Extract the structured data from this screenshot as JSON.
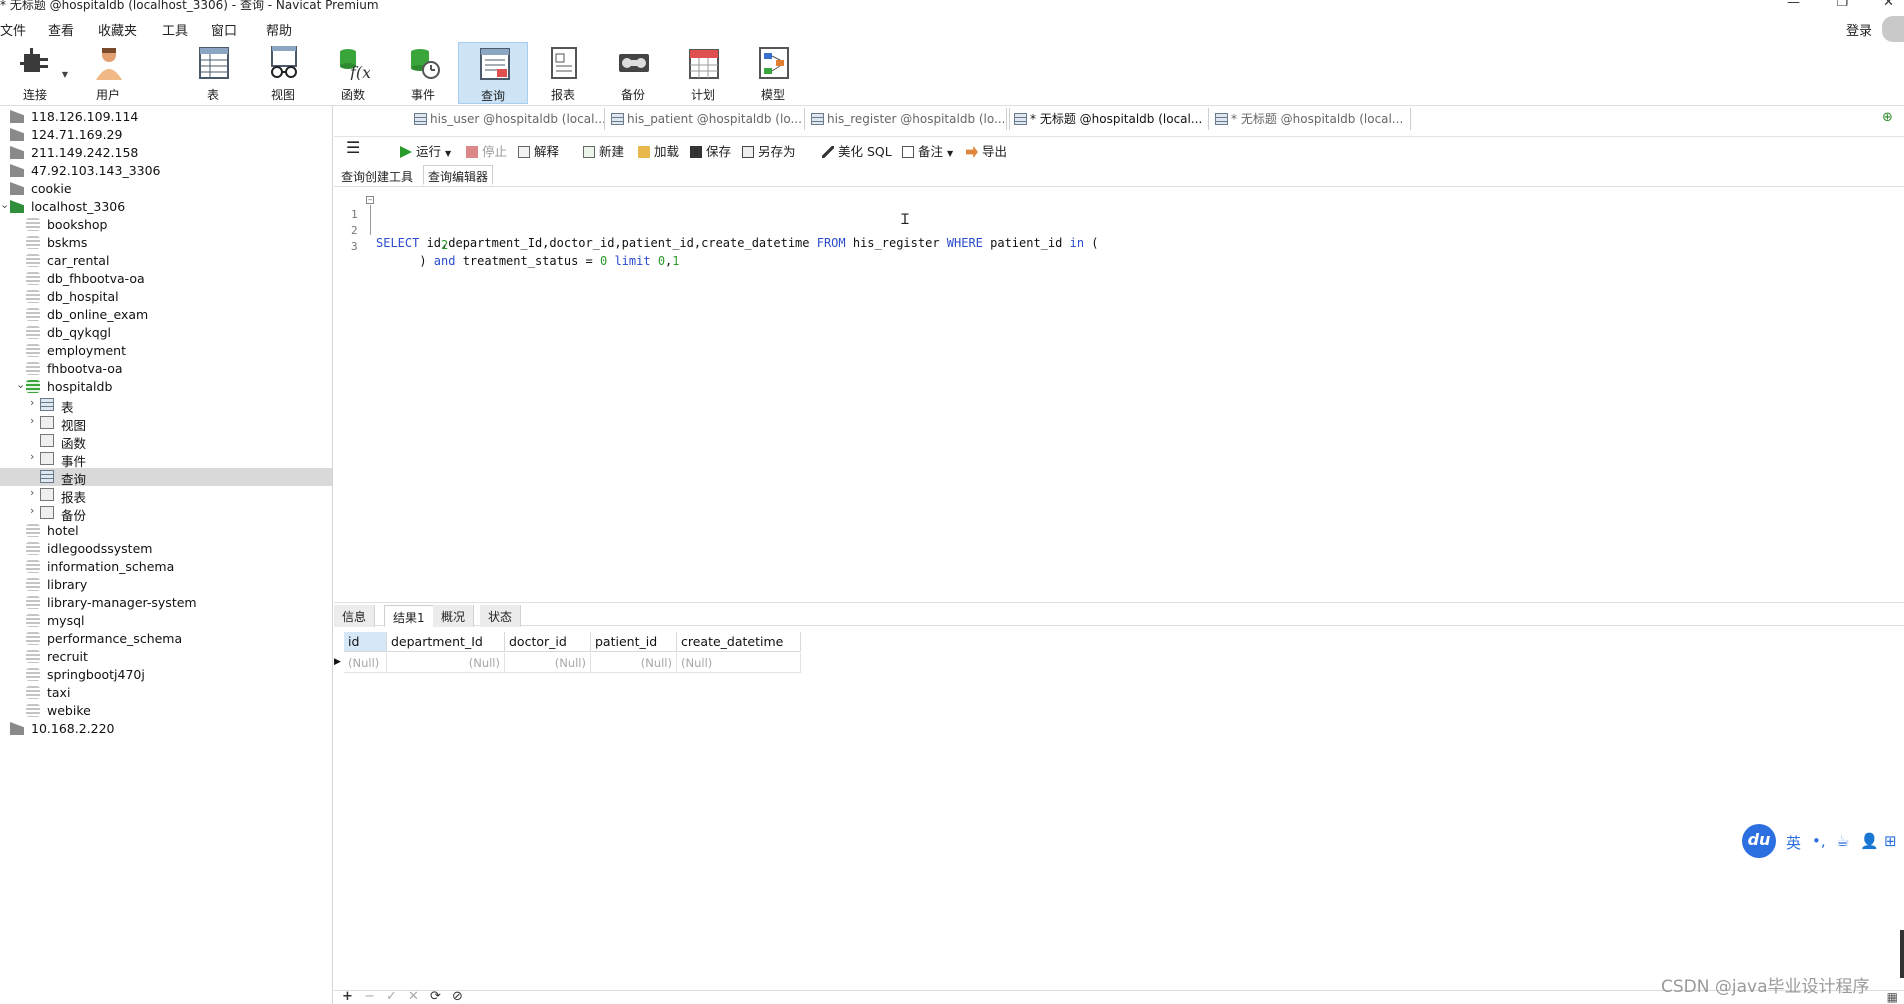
{
  "window": {
    "title": "* 无标题 @hospitaldb (localhost_3306) - 查询 - Navicat Premium",
    "controls": {
      "minimize": "—",
      "restore": "❐",
      "close": "✕"
    }
  },
  "menu": [
    "文件",
    "查看",
    "收藏夹",
    "工具",
    "窗口",
    "帮助"
  ],
  "login_label": "登录",
  "toolbar": [
    {
      "id": "connect",
      "label": "连接",
      "icon": "plug-icon"
    },
    {
      "id": "user",
      "label": "用户",
      "icon": "user-icon"
    },
    {
      "id": "table",
      "label": "表",
      "icon": "table-icon"
    },
    {
      "id": "view",
      "label": "视图",
      "icon": "glasses-icon"
    },
    {
      "id": "function",
      "label": "函数",
      "icon": "function-icon"
    },
    {
      "id": "event",
      "label": "事件",
      "icon": "event-icon"
    },
    {
      "id": "query",
      "label": "查询",
      "icon": "query-icon"
    },
    {
      "id": "report",
      "label": "报表",
      "icon": "report-icon"
    },
    {
      "id": "backup",
      "label": "备份",
      "icon": "backup-icon"
    },
    {
      "id": "schedule",
      "label": "计划",
      "icon": "calendar-icon"
    },
    {
      "id": "model",
      "label": "模型",
      "icon": "model-icon"
    }
  ],
  "tree": [
    {
      "label": "118.126.109.114",
      "level": 0,
      "type": "conn"
    },
    {
      "label": "124.71.169.29",
      "level": 0,
      "type": "conn"
    },
    {
      "label": "211.149.242.158",
      "level": 0,
      "type": "conn"
    },
    {
      "label": "47.92.103.143_3306",
      "level": 0,
      "type": "conn"
    },
    {
      "label": "cookie",
      "level": 0,
      "type": "conn"
    },
    {
      "label": "localhost_3306",
      "level": 0,
      "type": "conn-open",
      "arrow": "⌄"
    },
    {
      "label": "bookshop",
      "level": 1,
      "type": "db"
    },
    {
      "label": "bskms",
      "level": 1,
      "type": "db"
    },
    {
      "label": "car_rental",
      "level": 1,
      "type": "db"
    },
    {
      "label": "db_fhbootva-oa",
      "level": 1,
      "type": "db"
    },
    {
      "label": "db_hospital",
      "level": 1,
      "type": "db"
    },
    {
      "label": "db_online_exam",
      "level": 1,
      "type": "db"
    },
    {
      "label": "db_qykqgl",
      "level": 1,
      "type": "db"
    },
    {
      "label": "employment",
      "level": 1,
      "type": "db"
    },
    {
      "label": "fhbootva-oa",
      "level": 1,
      "type": "db"
    },
    {
      "label": "hospitaldb",
      "level": 1,
      "type": "db-open",
      "arrow": "⌄"
    },
    {
      "label": "表",
      "level": 2,
      "type": "tbl",
      "arrow": "›"
    },
    {
      "label": "视图",
      "level": 2,
      "type": "view",
      "arrow": "›"
    },
    {
      "label": "函数",
      "level": 2,
      "type": "func"
    },
    {
      "label": "事件",
      "level": 2,
      "type": "event",
      "arrow": "›"
    },
    {
      "label": "查询",
      "level": 2,
      "type": "query",
      "selected": true
    },
    {
      "label": "报表",
      "level": 2,
      "type": "report",
      "arrow": "›"
    },
    {
      "label": "备份",
      "level": 2,
      "type": "backup",
      "arrow": "›"
    },
    {
      "label": "hotel",
      "level": 1,
      "type": "db"
    },
    {
      "label": "idlegoodssystem",
      "level": 1,
      "type": "db"
    },
    {
      "label": "information_schema",
      "level": 1,
      "type": "db"
    },
    {
      "label": "library",
      "level": 1,
      "type": "db"
    },
    {
      "label": "library-manager-system",
      "level": 1,
      "type": "db"
    },
    {
      "label": "mysql",
      "level": 1,
      "type": "db"
    },
    {
      "label": "performance_schema",
      "level": 1,
      "type": "db"
    },
    {
      "label": "recruit",
      "level": 1,
      "type": "db"
    },
    {
      "label": "springbootj470j",
      "level": 1,
      "type": "db"
    },
    {
      "label": "taxi",
      "level": 1,
      "type": "db"
    },
    {
      "label": "webike",
      "level": 1,
      "type": "db"
    },
    {
      "label": "10.168.2.220",
      "level": 0,
      "type": "conn"
    }
  ],
  "tabs": [
    {
      "label": "his_user @hospitaldb (local..."
    },
    {
      "label": "his_patient @hospitaldb (lo..."
    },
    {
      "label": "his_register @hospitaldb (lo..."
    },
    {
      "label": "* 无标题 @hospitaldb (local...",
      "active": true
    },
    {
      "label": "* 无标题 @hospitaldb (local..."
    }
  ],
  "query_toolbar": {
    "menu": "☰",
    "run": "运行",
    "stop": "停止",
    "explain": "解释",
    "new": "新建",
    "load": "加载",
    "save": "保存",
    "save_as": "另存为",
    "beautify": "美化 SQL",
    "comment": "备注",
    "export": "导出"
  },
  "subtabs": [
    "查询创建工具",
    "查询编辑器"
  ],
  "sql": {
    "line1": {
      "n": "1",
      "parts": [
        [
          "kw",
          "SELECT"
        ],
        [
          "ident",
          " id,department_Id,doctor_id,patient_id,create_datetime "
        ],
        [
          "kw",
          "FROM"
        ],
        [
          "ident",
          " his_register "
        ],
        [
          "kw",
          "WHERE"
        ],
        [
          "ident",
          " patient_id "
        ],
        [
          "kw",
          "in"
        ],
        [
          "ident",
          " ("
        ]
      ]
    },
    "line2": {
      "n": "2",
      "parts": [
        [
          "ident",
          "         "
        ],
        [
          "num",
          "2"
        ]
      ]
    },
    "line3": {
      "n": "3",
      "parts": [
        [
          "ident",
          "      ) "
        ],
        [
          "kw",
          "and"
        ],
        [
          "ident",
          " treatment_status = "
        ],
        [
          "num",
          "0"
        ],
        [
          "ident",
          " "
        ],
        [
          "kw",
          "limit"
        ],
        [
          "ident",
          " "
        ],
        [
          "num",
          "0"
        ],
        [
          "ident",
          ","
        ],
        [
          "num",
          "1"
        ]
      ]
    }
  },
  "result_tabs": [
    "信息",
    "结果1",
    "概况",
    "状态"
  ],
  "result_grid": {
    "columns": [
      "id",
      "department_Id",
      "doctor_id",
      "patient_id",
      "create_datetime"
    ],
    "rows": [
      [
        "(Null)",
        "(Null)",
        "(Null)",
        "(Null)",
        "(Null)"
      ]
    ]
  },
  "bottom_buttons": [
    "+",
    "−",
    "✓",
    "✕",
    "⟳",
    "⊘"
  ],
  "ime": {
    "logo": "du",
    "items": [
      "英",
      "•,",
      "☕",
      "👤",
      "⊞"
    ]
  },
  "watermark": "CSDN @java毕业设计程序"
}
